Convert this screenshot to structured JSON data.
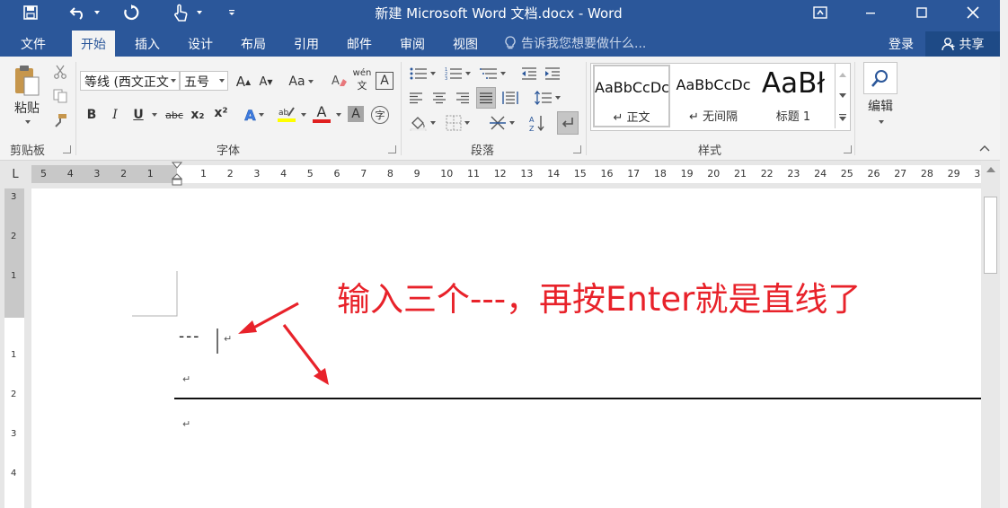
{
  "title_bar": {
    "title": "新建 Microsoft Word 文档.docx - Word"
  },
  "tabs": [
    {
      "label": "文件"
    },
    {
      "label": "开始",
      "active": true
    },
    {
      "label": "插入"
    },
    {
      "label": "设计"
    },
    {
      "label": "布局"
    },
    {
      "label": "引用"
    },
    {
      "label": "邮件"
    },
    {
      "label": "审阅"
    },
    {
      "label": "视图"
    }
  ],
  "tell_me": {
    "placeholder": "告诉我您想要做什么..."
  },
  "account": {
    "login_label": "登录",
    "share_label": "共享"
  },
  "ribbon": {
    "clipboard": {
      "paste_label": "粘贴",
      "group_label": "剪贴板"
    },
    "font": {
      "font_name": "等线 (西文正文",
      "font_size": "五号",
      "bold": "B",
      "italic": "I",
      "underline": "U",
      "strike": "abc",
      "subscript": "x₂",
      "superscript": "x²",
      "case": "Aa",
      "phonetic": "wén",
      "grow": "A",
      "shrink": "A",
      "font_color": "A",
      "char_shade": "A",
      "enclosed": "字",
      "group_label": "字体"
    },
    "paragraph": {
      "group_label": "段落"
    },
    "styles": {
      "items": [
        {
          "preview": "AaBbCcDc",
          "name": "↵ 正文"
        },
        {
          "preview": "AaBbCcDc",
          "name": "↵ 无间隔"
        },
        {
          "preview": "AaBł",
          "name": "标题 1"
        }
      ],
      "group_label": "样式"
    },
    "editing": {
      "label": "编辑"
    },
    "accent_color": "#2b579a"
  },
  "ruler": {
    "corner": "L",
    "left_numbers": [
      "5",
      "4",
      "3",
      "2",
      "1"
    ],
    "right_numbers": [
      "1",
      "2",
      "3",
      "4",
      "5",
      "6",
      "7",
      "8",
      "9",
      "10",
      "11",
      "12",
      "13",
      "14",
      "15",
      "16",
      "17",
      "18",
      "19",
      "20",
      "21",
      "22",
      "23",
      "24",
      "25",
      "26",
      "27",
      "28",
      "29",
      "30"
    ],
    "vertical_numbers": [
      "3",
      "2",
      "1",
      "1",
      "2",
      "3",
      "4"
    ]
  },
  "document": {
    "typed_text": "---",
    "paragraph_mark": "↵",
    "annotation": "输入三个---，再按Enter就是直线了",
    "annotation_color": "#e8222a"
  }
}
